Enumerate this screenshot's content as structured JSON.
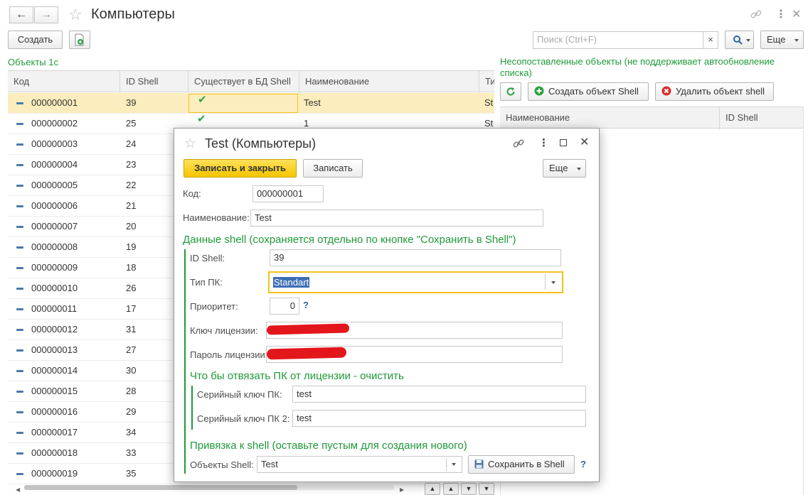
{
  "window": {
    "title": "Компьютеры",
    "search_placeholder": "Поиск (Ctrl+F)",
    "create_label": "Создать",
    "more_label": "Еще",
    "icons": [
      "back-arrow-icon",
      "forward-arrow-icon",
      "star-icon",
      "link-icon",
      "more-vertical-icon",
      "close-icon",
      "add-document-icon",
      "search-icon"
    ]
  },
  "left": {
    "section_title": "Объекты 1с",
    "columns": [
      "Код",
      "ID Shell",
      "Существует в БД Shell",
      "Наименование",
      "Ти"
    ],
    "rows": [
      {
        "code": "000000001",
        "id": "39",
        "exists": true,
        "name": "Test",
        "type": "St"
      },
      {
        "code": "000000002",
        "id": "25",
        "exists": true,
        "name": "1",
        "type": "St"
      },
      {
        "code": "000000003",
        "id": "24"
      },
      {
        "code": "000000004",
        "id": "23"
      },
      {
        "code": "000000005",
        "id": "22"
      },
      {
        "code": "000000006",
        "id": "21"
      },
      {
        "code": "000000007",
        "id": "20"
      },
      {
        "code": "000000008",
        "id": "19"
      },
      {
        "code": "000000009",
        "id": "18"
      },
      {
        "code": "000000010",
        "id": "26"
      },
      {
        "code": "000000011",
        "id": "17"
      },
      {
        "code": "000000012",
        "id": "31"
      },
      {
        "code": "000000013",
        "id": "27"
      },
      {
        "code": "000000014",
        "id": "30"
      },
      {
        "code": "000000015",
        "id": "28"
      },
      {
        "code": "000000016",
        "id": "29"
      },
      {
        "code": "000000017",
        "id": "34"
      },
      {
        "code": "000000018",
        "id": "33"
      },
      {
        "code": "000000019",
        "id": "35"
      }
    ]
  },
  "right": {
    "title": "Несопоставленные объекты (не поддерживает автообновление списка)",
    "create_shell": "Создать объект Shell",
    "delete_shell": "Удалить объект shell",
    "columns": [
      "Наименование",
      "ID Shell"
    ]
  },
  "dialog": {
    "title": "Test (Компьютеры)",
    "save_close": "Записать и закрыть",
    "save": "Записать",
    "more": "Еще",
    "code_label": "Код:",
    "code_value": "000000001",
    "name_label": "Наименование:",
    "name_value": "Test",
    "shell_group_title": "Данные shell (сохраняется отдельно по кнопке \"Сохранить в Shell\")",
    "id_label": "ID Shell:",
    "id_value": "39",
    "type_label": "Тип ПК:",
    "type_value": "Standart",
    "priority_label": "Приоритет:",
    "priority_value": "0",
    "help": "?",
    "license_key_label": "Ключ лицензии:",
    "license_pass_label": "Пароль лицензии:",
    "unbind_title": "Что бы отвязать ПК от лицензии - очистить",
    "serial_label": "Серийный ключ ПК:",
    "serial_value": "test",
    "serial2_label": "Серийный ключ ПК 2:",
    "serial2_value": "test",
    "bind_title": "Привязка к shell (оставьте пустым для создания нового)",
    "objects_label": "Объекты Shell:",
    "objects_value": "Test",
    "save_shell": "Сохранить в Shell"
  }
}
